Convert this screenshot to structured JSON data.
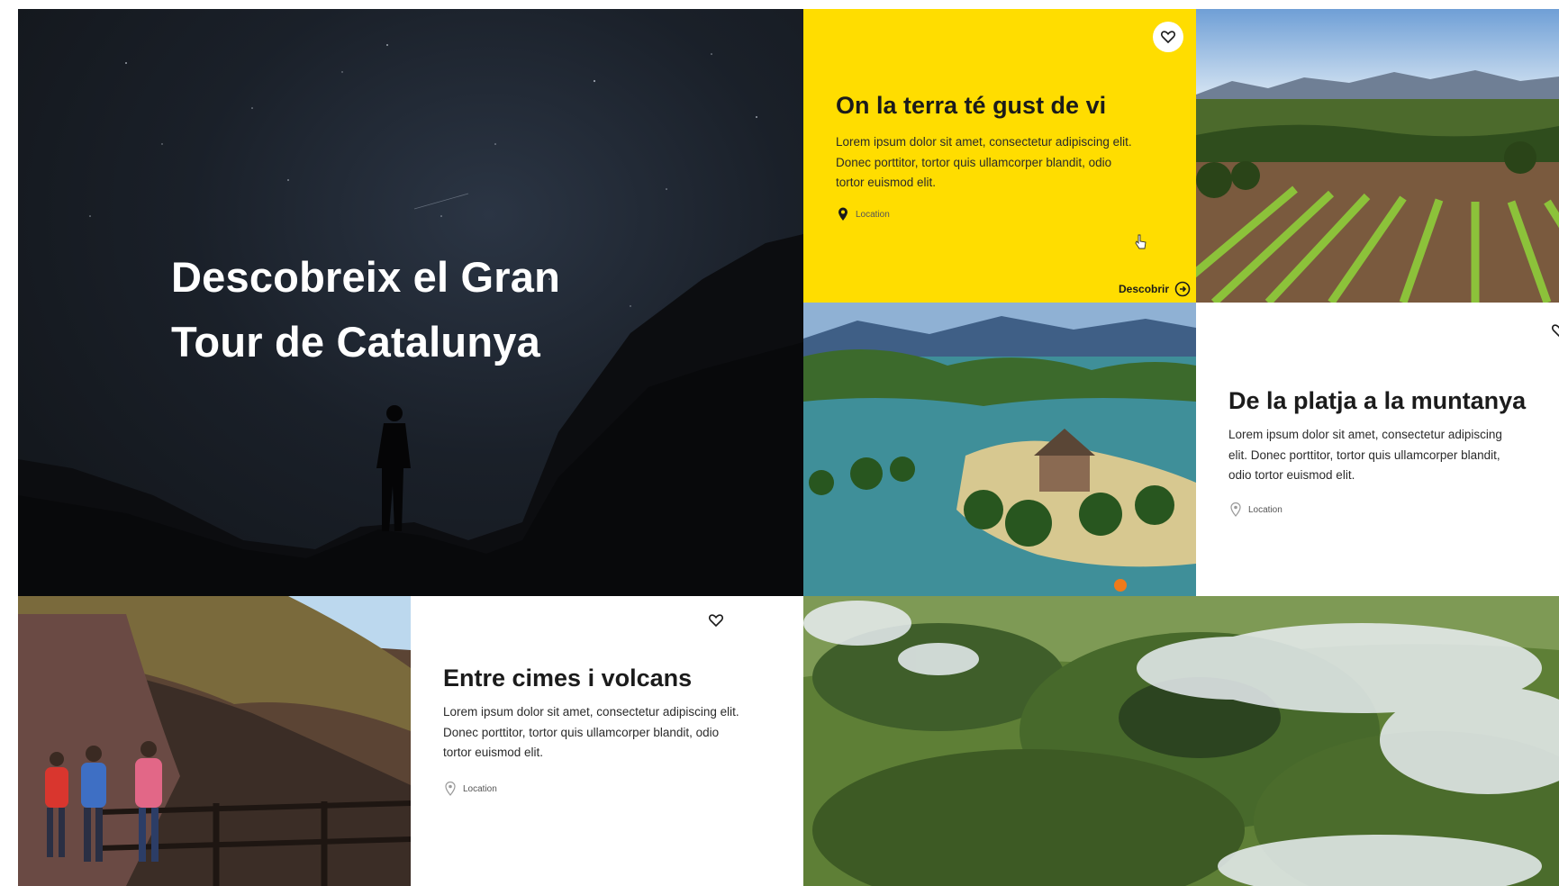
{
  "hero": {
    "title_line1": "Descobreix el Gran",
    "title_line2": "Tour de Catalunya"
  },
  "cards": [
    {
      "title": "On la terra té gust de vi",
      "body": "Lorem ipsum dolor sit amet, consectetur adipiscing elit. Donec porttitor, tortor quis ullamcorper blandit, odio tortor euismod elit.",
      "location": "Location",
      "cta": "Descobrir",
      "background": "#ffdd00"
    },
    {
      "title": "De la platja a la muntanya",
      "body": "Lorem ipsum dolor sit amet, consectetur adipiscing elit. Donec porttitor, tortor quis ullamcorper blandit, odio tortor euismod elit.",
      "location": "Location"
    },
    {
      "title": "Entre cimes i volcans",
      "body": "Lorem ipsum dolor sit amet, consectetur adipiscing elit. Donec porttitor, tortor quis ullamcorper blandit, odio tortor euismod elit.",
      "location": "Location"
    }
  ],
  "icons": {
    "favorite": "heart-icon",
    "location": "location-pin-icon",
    "cta": "arrow-circle-icon",
    "pointer": "hand-cursor-icon"
  },
  "colors": {
    "accent_yellow": "#ffdd00",
    "text_dark": "#1b1b1b"
  }
}
